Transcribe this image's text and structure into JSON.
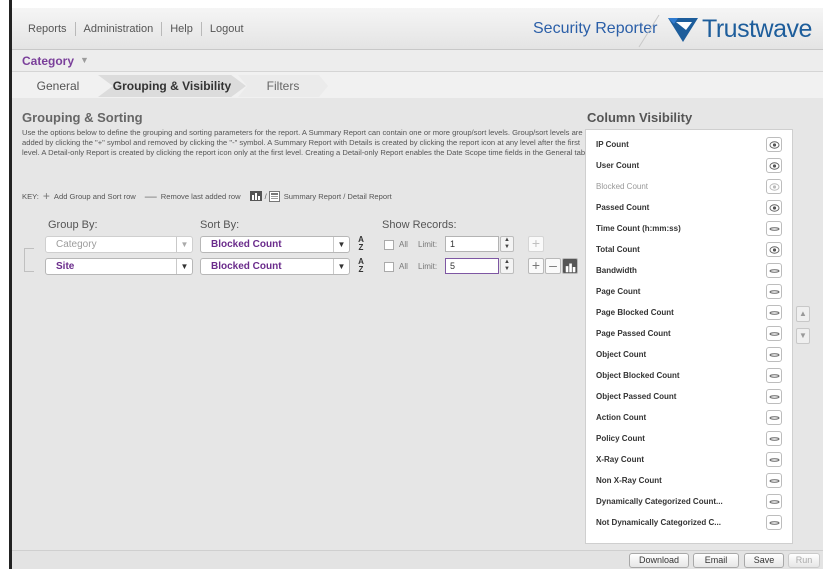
{
  "header": {
    "nav": [
      "Reports",
      "Administration",
      "Help",
      "Logout"
    ],
    "product_title": "Security Reporter",
    "brand": "Trustwave",
    "brand_mark": "trustwave-logo-icon"
  },
  "category": {
    "title": "Category"
  },
  "tabs": [
    "General",
    "Grouping & Visibility",
    "Filters"
  ],
  "active_tab": "Grouping & Visibility",
  "grouping": {
    "title": "Grouping & Sorting",
    "description": "Use the options below to define the grouping and sorting parameters for the report. A Summary Report can contain one or more group/sort levels. Group/sort levels are added by clicking the \"+\" symbol and removed by clicking the \"-\" symbol. A Summary Report with Details is created by clicking the report icon at any level after the first level. A Detail-only Report is created by clicking the report icon only at the first level. Creating a Detail-only Report enables the Date Scope time fields in the General tab.",
    "key_label": "KEY:",
    "key_add": "Add Group and Sort row",
    "key_remove": "Remove last added row",
    "key_slash": "/",
    "key_report": "Summary Report / Detail Report",
    "headers": {
      "group_by": "Group By:",
      "sort_by": "Sort By:",
      "show_records": "Show Records:"
    },
    "all_label": "All",
    "limit_label": "Limit:",
    "rows": [
      {
        "group": "Category",
        "sort": "Blocked Count",
        "limit": "1",
        "disabled": true
      },
      {
        "group": "Site",
        "sort": "Blocked Count",
        "limit": "5",
        "disabled": false
      }
    ]
  },
  "column_visibility": {
    "title": "Column Visibility",
    "items": [
      {
        "name": "IP Count",
        "visible": true
      },
      {
        "name": "User Count",
        "visible": true
      },
      {
        "name": "Blocked Count",
        "visible": true,
        "locked": true
      },
      {
        "name": "Passed Count",
        "visible": true
      },
      {
        "name": "Time Count (h:mm:ss)",
        "visible": false
      },
      {
        "name": "Total Count",
        "visible": true
      },
      {
        "name": "Bandwidth",
        "visible": false
      },
      {
        "name": "Page Count",
        "visible": false
      },
      {
        "name": "Page Blocked Count",
        "visible": false
      },
      {
        "name": "Page Passed Count",
        "visible": false
      },
      {
        "name": "Object Count",
        "visible": false
      },
      {
        "name": "Object Blocked Count",
        "visible": false
      },
      {
        "name": "Object Passed Count",
        "visible": false
      },
      {
        "name": "Action Count",
        "visible": false
      },
      {
        "name": "Policy Count",
        "visible": false
      },
      {
        "name": "X-Ray Count",
        "visible": false
      },
      {
        "name": "Non X-Ray Count",
        "visible": false
      },
      {
        "name": "Dynamically Categorized Count...",
        "visible": false
      },
      {
        "name": "Not Dynamically Categorized C...",
        "visible": false
      }
    ]
  },
  "footer": {
    "download": "Download",
    "email": "Email",
    "save": "Save",
    "run": "Run"
  },
  "colors": {
    "accent": "#6a2b8b",
    "brand": "#1d5d9b",
    "product": "#2b5fa8"
  }
}
